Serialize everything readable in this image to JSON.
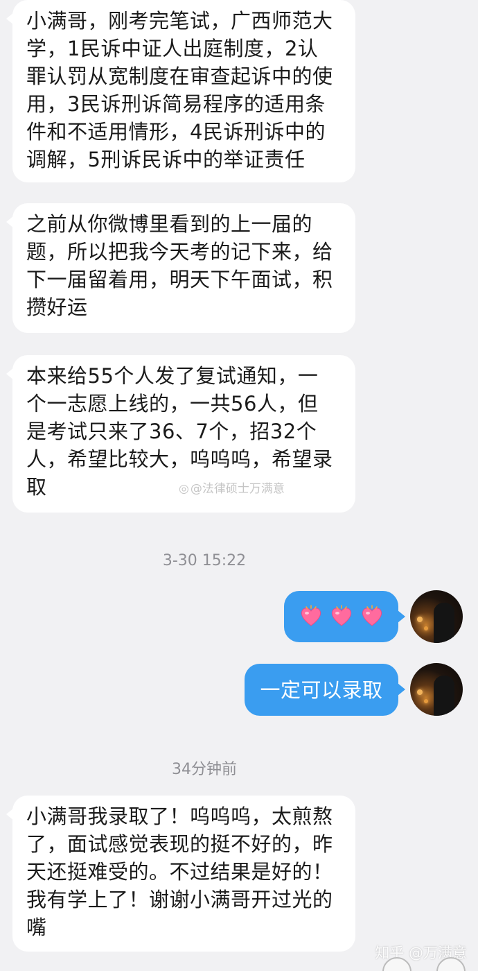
{
  "messages": [
    {
      "id": "b1",
      "direction": "incoming",
      "lines": [
        "小满哥，刚考完笔试，广西师范大",
        "学，1民诉中证人出庭制度，2认",
        "罪认罚从宽制度在审查起诉中的使",
        "用，3民诉刑诉简易程序的适用条",
        "件和不适用情形，4民诉刑诉中的",
        "调解，5刑诉民诉中的举证责任"
      ]
    },
    {
      "id": "b2",
      "direction": "incoming",
      "lines": [
        "之前从你微博里看到的上一届的",
        "题，所以把我今天考的记下来，给",
        "下一届留着用，明天下午面试，积",
        "攒好运"
      ]
    },
    {
      "id": "b3",
      "direction": "incoming",
      "lines": [
        "本来给55个人发了复试通知，一",
        "个一志愿上线的，一共56人，但",
        "是考试只来了36、7个，招32个",
        "人，希望比较大，呜呜呜，希望录",
        "取"
      ]
    },
    {
      "id": "b4",
      "direction": "incoming",
      "lines": [
        "小满哥我录取了！呜呜呜，太煎熬",
        "了，面试感觉表现的挺不好的，昨",
        "天还挺难受的。不过结果是好的！",
        "我有学上了！谢谢小满哥开过光的",
        "嘴"
      ]
    }
  ],
  "timestamps": {
    "first": "3-30 15:22",
    "second": "34分钟前"
  },
  "outgoing": {
    "hearts_icon": "heart-emoji-icon",
    "heart_count": 3,
    "reply_text": "一定可以录取"
  },
  "watermark": {
    "weibo_text": "@法律硕士万满意"
  },
  "zhihu_watermark": "知乎 @万满意",
  "colors": {
    "background": "#f1f1f3",
    "incoming_bubble": "#ffffff",
    "outgoing_bubble": "#3a9df0",
    "timestamp_text": "#8f8f94"
  }
}
